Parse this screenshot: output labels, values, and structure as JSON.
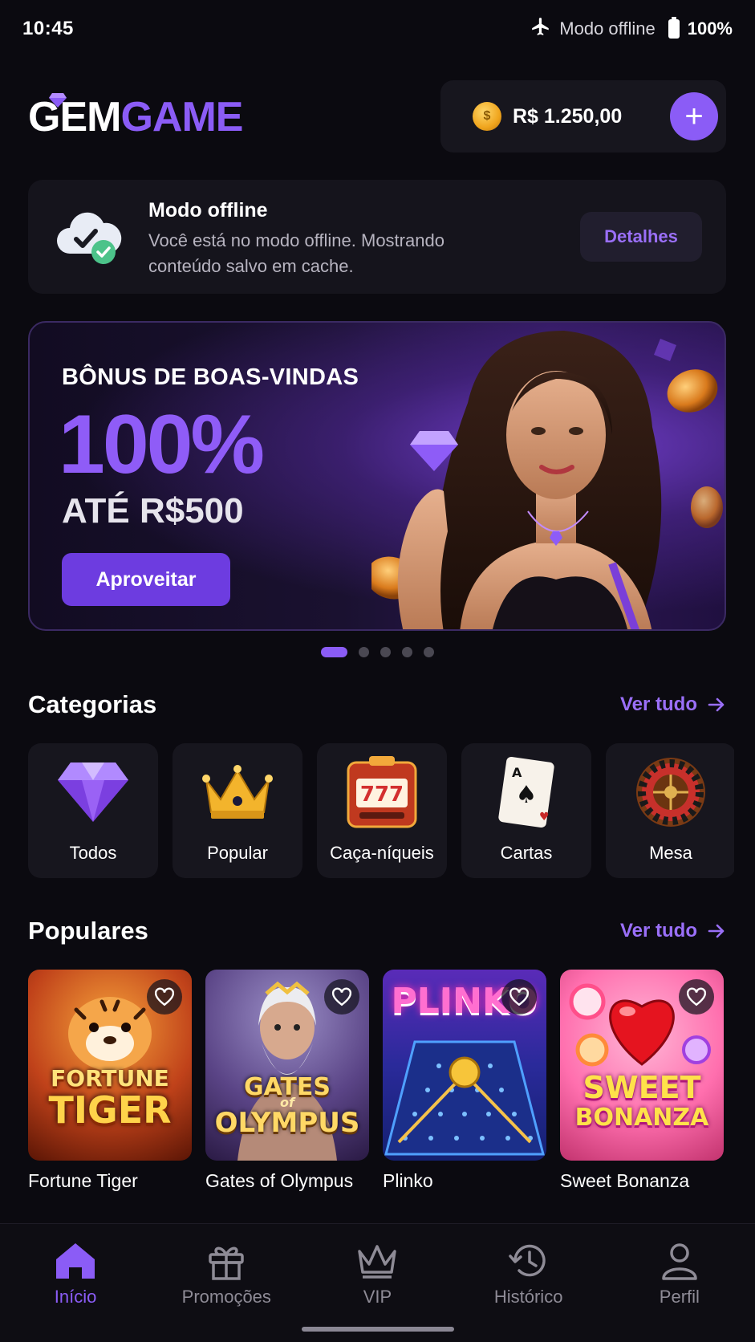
{
  "status_bar": {
    "time": "10:45",
    "mode": "Modo offline",
    "battery": "100%"
  },
  "header": {
    "logo_part1": "GEM",
    "logo_part2": "GAME",
    "balance": "R$ 1.250,00",
    "add_label": "+"
  },
  "offline_banner": {
    "title": "Modo offline",
    "message": "Você está no modo offline. Mostrando conteúdo salvo em cache.",
    "details_label": "Detalhes"
  },
  "hero": {
    "subtitle": "BÔNUS DE BOAS-VINDAS",
    "percent": "100%",
    "upto": "ATÉ R$500",
    "cta": "Aproveitar",
    "slides": 5,
    "active_slide": 1
  },
  "categories": {
    "title": "Categorias",
    "see_all": "Ver tudo",
    "items": [
      {
        "label": "Todos",
        "icon": "diamond-icon"
      },
      {
        "label": "Popular",
        "icon": "crown-icon"
      },
      {
        "label": "Caça-níqueis",
        "icon": "slot-machine-icon"
      },
      {
        "label": "Cartas",
        "icon": "playing-card-icon"
      },
      {
        "label": "Mesa",
        "icon": "roulette-icon"
      }
    ]
  },
  "popular": {
    "title": "Populares",
    "see_all": "Ver tudo",
    "games": [
      {
        "name": "Fortune Tiger",
        "thumb_line1": "FORTUNE",
        "thumb_line2": "TIGER"
      },
      {
        "name": "Gates of Olympus",
        "thumb_line1": "GATES",
        "thumb_small": "of",
        "thumb_line2": "OLYMPUS"
      },
      {
        "name": "Plinko",
        "thumb_line1": "PLINKO"
      },
      {
        "name": "Sweet Bonanza",
        "thumb_line1": "SWEET",
        "thumb_line2": "BONANZA"
      }
    ]
  },
  "nav": {
    "items": [
      {
        "label": "Início",
        "icon": "home-icon",
        "active": true
      },
      {
        "label": "Promoções",
        "icon": "gift-icon",
        "active": false
      },
      {
        "label": "VIP",
        "icon": "crown-icon",
        "active": false
      },
      {
        "label": "Histórico",
        "icon": "history-icon",
        "active": false
      },
      {
        "label": "Perfil",
        "icon": "user-icon",
        "active": false
      }
    ]
  },
  "colors": {
    "accent": "#8b5cf6",
    "background": "#0b0a10",
    "card": "#17161e"
  }
}
